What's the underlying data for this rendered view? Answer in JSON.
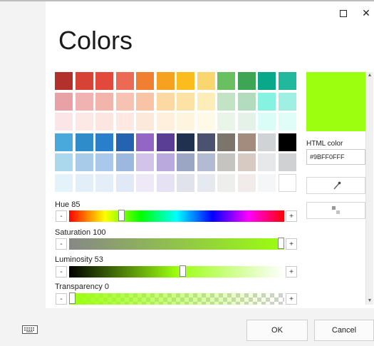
{
  "window": {
    "title": "Colors",
    "maximize_icon": "maximize-icon",
    "close_icon": "close-icon",
    "close_glyph": "✕"
  },
  "palette": {
    "rows": [
      [
        "#b3312c",
        "#d74236",
        "#e3493a",
        "#ec6a54",
        "#f07f31",
        "#f6a11f",
        "#fbbd1e",
        "#f9d670",
        "#68c061",
        "#3da553",
        "#09a88b",
        "#21b89d"
      ],
      [
        "#e8a2a6",
        "#f0b3b1",
        "#f3b4ab",
        "#f8c2b3",
        "#f9c4a5",
        "#fcd9a3",
        "#fde2a6",
        "#fdeeb9",
        "#c2e3c4",
        "#b3dcbf",
        "#86f3e1",
        "#9ff0e2"
      ],
      [
        "#fbe5e6",
        "#fce9e6",
        "#fde5e1",
        "#fde8e2",
        "#fde9dc",
        "#fef0dc",
        "#fff4dd",
        "#fffae7",
        "#e8f5e8",
        "#e4f2e8",
        "#dbfdf7",
        "#e1fdf7"
      ],
      [
        "#4aa9dc",
        "#2f8ccb",
        "#2a7fcc",
        "#2563b0",
        "#9365c4",
        "#5a3d94",
        "#20304f",
        "#4a5270",
        "#7b756c",
        "#a38b7d",
        "#d0d3d6",
        "#000000"
      ],
      [
        "#acd8ee",
        "#a8cbea",
        "#a9c8ec",
        "#9db8e0",
        "#d2c3ea",
        "#baa9dd",
        "#9ba6c4",
        "#b3bbd2",
        "#c5c4c1",
        "#d7cac2",
        "#e6e8ea",
        "#d0d1d3"
      ],
      [
        "#e4f2f9",
        "#e2eef8",
        "#e4eef9",
        "#e0e9f5",
        "#efe8f7",
        "#e7e2f3",
        "#e0e3ec",
        "#e6e9ef",
        "#eeeeed",
        "#f1ece9",
        "#f5f6f7",
        "#ffffff"
      ]
    ]
  },
  "sliders": {
    "hue": {
      "label": "Hue 85",
      "value": 85,
      "max": 360
    },
    "saturation": {
      "label": "Saturation 100",
      "value": 100,
      "max": 100
    },
    "luminosity": {
      "label": "Luminosity 53",
      "value": 53,
      "max": 100
    },
    "transparency": {
      "label": "Transparency 0",
      "value": 0,
      "max": 100
    },
    "minus": "-",
    "plus": "+"
  },
  "preview": {
    "color": "#9BFF0F"
  },
  "html_color": {
    "label": "HTML color",
    "value": "#9BFF0FFF"
  },
  "tools": {
    "eyedropper_icon": "eyedropper-icon",
    "screen_picker_icon": "screen-picker-icon"
  },
  "buttons": {
    "ok": "OK",
    "cancel": "Cancel"
  },
  "keyboard_icon": "keyboard-icon",
  "scrollbar": {
    "up": "▲",
    "down": "▼"
  }
}
